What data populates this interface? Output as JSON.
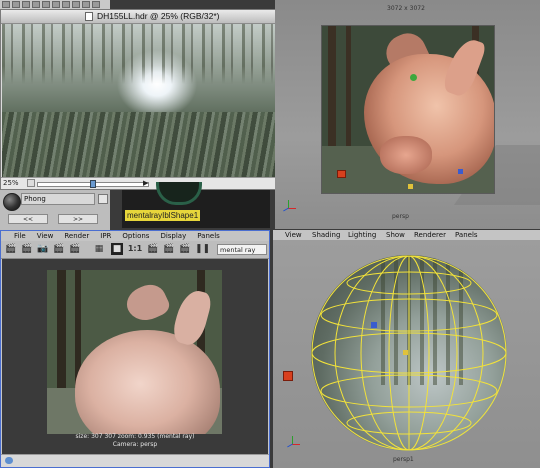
{
  "hdr_window": {
    "title": "DH155LL.hdr @ 25% (RGB/32*)",
    "zoom": "25%",
    "slider_fraction": 0.5
  },
  "material_panel": {
    "shader_name": "Phong",
    "prev_label": "<<",
    "next_label": ">>"
  },
  "hypershade_node": {
    "label": "mentalrayIblShape1"
  },
  "viewport_top": {
    "resolution": "3072 x 3072",
    "camera": "persp"
  },
  "render_view": {
    "menu": [
      "File",
      "View",
      "Render",
      "IPR",
      "Options",
      "Display",
      "Panels"
    ],
    "scale_label": "1:1",
    "renderer_field": "mental ray",
    "info_line": "size:  307  307 zoom: 0.935          (mental ray)",
    "camera_line": "Camera: persp"
  },
  "viewport_bottom": {
    "menu": [
      "View",
      "Shading",
      "Lighting",
      "Show",
      "Renderer",
      "Panels"
    ],
    "camera": "persp1"
  },
  "colors": {
    "render_view_border": "#4a6ed0",
    "node_label_bg": "#e7d63b",
    "wireframe": "#f2e23a",
    "locator": "#d8401e"
  }
}
